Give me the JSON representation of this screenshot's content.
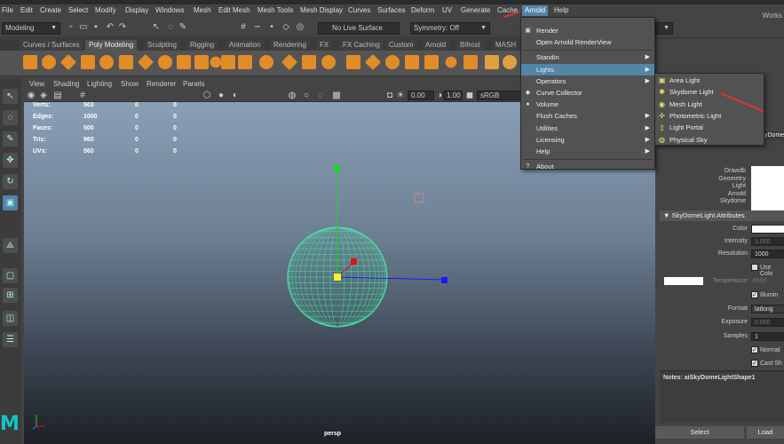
{
  "menubar": {
    "items": [
      "File",
      "Edit",
      "Create",
      "Select",
      "Modify",
      "Display",
      "Windows",
      "Mesh",
      "Edit Mesh",
      "Mesh Tools",
      "Mesh Display",
      "Curves",
      "Surfaces",
      "Deform",
      "UV",
      "Generate",
      "Cache",
      "Arnold",
      "Help"
    ],
    "workspace": "Works"
  },
  "statusline": {
    "mode": "Modeling",
    "live_surface": "No Live Surface",
    "symmetry": "Symmetry: Off"
  },
  "shelf_tabs": [
    "Curves / Surfaces",
    "Poly Modeling",
    "Sculpting",
    "Rigging",
    "Animation",
    "Rendering",
    "FX",
    "FX Caching",
    "Custom",
    "Arnold",
    "Bifrost",
    "MASH"
  ],
  "shelf_active": "Poly Modeling",
  "viewport": {
    "menu": [
      "View",
      "Shading",
      "Lighting",
      "Show",
      "Renderer",
      "Panels"
    ],
    "field1": "0.00",
    "field2": "1.00",
    "colorspace": "sRGB gamma",
    "camera": "persp",
    "hud": [
      {
        "label": "Verts:",
        "v1": "503",
        "v2": "0",
        "v3": "0"
      },
      {
        "label": "Edges:",
        "v1": "1000",
        "v2": "0",
        "v3": "0"
      },
      {
        "label": "Faces:",
        "v1": "500",
        "v2": "0",
        "v3": "0"
      },
      {
        "label": "Tris:",
        "v1": "960",
        "v2": "0",
        "v3": "0"
      },
      {
        "label": "UVs:",
        "v1": "560",
        "v2": "0",
        "v3": "0"
      }
    ]
  },
  "arnold_menu": {
    "items": [
      {
        "label": "Render",
        "icon": "render-icon",
        "sub": false
      },
      {
        "label": "Open Arnold RenderView",
        "icon": "",
        "sub": false
      },
      {
        "label": "StandIn",
        "icon": "",
        "sub": true
      },
      {
        "label": "Lights",
        "icon": "",
        "sub": true
      },
      {
        "label": "Operators",
        "icon": "",
        "sub": true
      },
      {
        "label": "Curve Collector",
        "icon": "curve-icon",
        "sub": false
      },
      {
        "label": "Volume",
        "icon": "volume-icon",
        "sub": false
      },
      {
        "label": "Flush Caches",
        "icon": "",
        "sub": true
      },
      {
        "label": "Utilities",
        "icon": "",
        "sub": true
      },
      {
        "label": "Licensing",
        "icon": "",
        "sub": true
      },
      {
        "label": "Help",
        "icon": "",
        "sub": true
      },
      {
        "label": "About",
        "icon": "info-icon",
        "sub": false
      }
    ],
    "highlighted": "Lights"
  },
  "lights_menu": {
    "items": [
      "Area Light",
      "Skydome Light",
      "Mesh Light",
      "Photometric Light",
      "Light Portal",
      "Physical Sky"
    ]
  },
  "attr_panel": {
    "tab": "yDome",
    "info": [
      "Drawdb",
      "Geometry",
      "Light",
      "Arnold",
      "Skydome"
    ],
    "section": "SkyDomeLight Attributes",
    "color_label": "Color",
    "intensity_label": "Intensity",
    "intensity": "1.000",
    "resolution_label": "Resolution",
    "resolution": "1000",
    "use_color": "Use Colo",
    "temperature_label": "Temperature",
    "temperature": "6500",
    "illuminates": "Illumin",
    "format_label": "Format",
    "format": "latlong",
    "exposure_label": "Exposure",
    "exposure": "0.000",
    "samples_label": "Samples",
    "samples": "1",
    "normalize": "Normal",
    "cast_shadows": "Cast Sh",
    "notes": "Notes:  aiSkyDomeLightShape1",
    "select_btn": "Select",
    "load_btn": "Load"
  },
  "colors": {
    "accent": "#5285a6",
    "sphere": "#4de8a8",
    "arrow": "#e53030",
    "maya_logo": "#11c5c5"
  }
}
